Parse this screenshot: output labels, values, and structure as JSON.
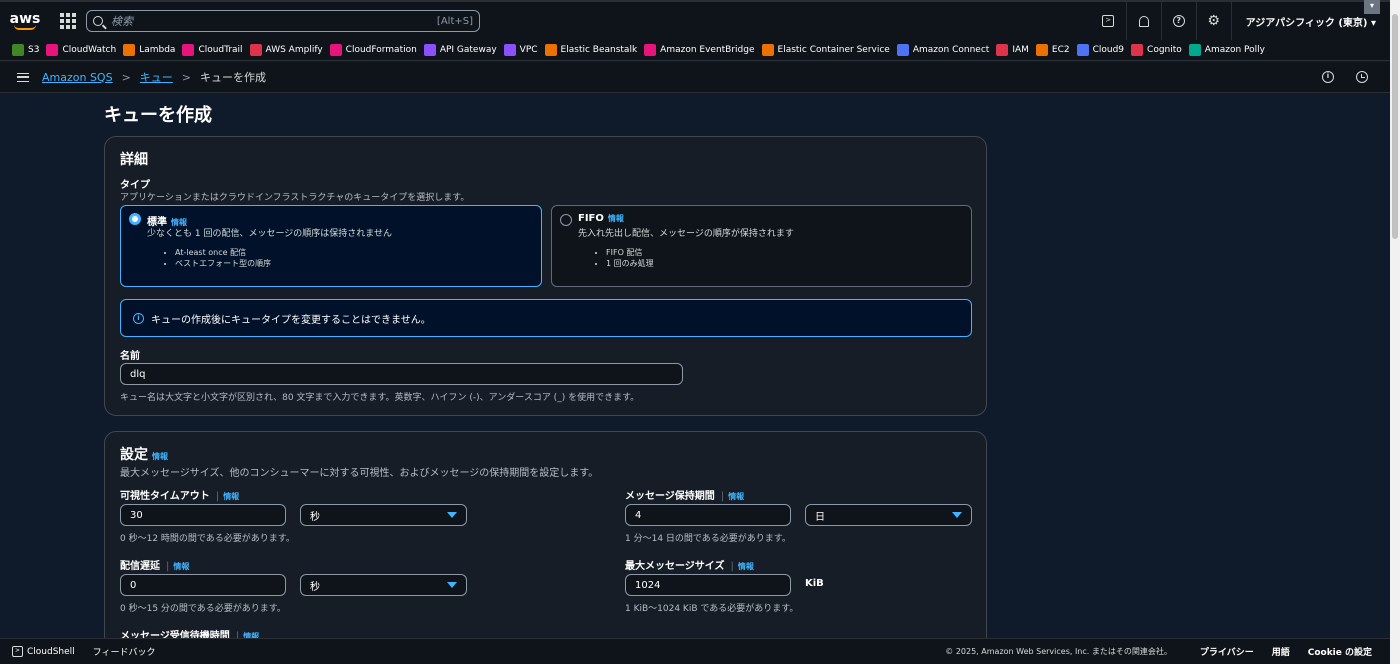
{
  "topbar": {
    "logo": "aws",
    "search_placeholder": "検索",
    "search_shortcut": "[Alt+S]",
    "region": "アジアパシフィック (東京) ▾",
    "corner": "▾"
  },
  "favorites": [
    {
      "label": "S3",
      "color": "#3f8624"
    },
    {
      "label": "CloudWatch",
      "color": "#e7157b"
    },
    {
      "label": "Lambda",
      "color": "#ed7100"
    },
    {
      "label": "CloudTrail",
      "color": "#e7157b"
    },
    {
      "label": "AWS Amplify",
      "color": "#dd344c"
    },
    {
      "label": "CloudFormation",
      "color": "#e7157b"
    },
    {
      "label": "API Gateway",
      "color": "#8c4fff"
    },
    {
      "label": "VPC",
      "color": "#8c4fff"
    },
    {
      "label": "Elastic Beanstalk",
      "color": "#ed7100"
    },
    {
      "label": "Amazon EventBridge",
      "color": "#e7157b"
    },
    {
      "label": "Elastic Container Service",
      "color": "#ed7100"
    },
    {
      "label": "Amazon Connect",
      "color": "#4d72f3"
    },
    {
      "label": "IAM",
      "color": "#dd344c"
    },
    {
      "label": "EC2",
      "color": "#ed7100"
    },
    {
      "label": "Cloud9",
      "color": "#4d72f3"
    },
    {
      "label": "Cognito",
      "color": "#dd344c"
    },
    {
      "label": "Amazon Polly",
      "color": "#01a88d"
    }
  ],
  "breadcrumb": {
    "items": [
      "Amazon SQS",
      "キュー"
    ],
    "current": "キューを作成",
    "sep": ">"
  },
  "page": {
    "title": "キューを作成"
  },
  "details": {
    "heading": "詳細",
    "type_label": "タイプ",
    "type_desc": "アプリケーションまたはクラウドインフラストラクチャのキュータイプを選択します。",
    "standard": {
      "title": "標準",
      "info": "情報",
      "desc": "少なくとも 1 回の配信、メッセージの順序は保持されません",
      "bullets": [
        "At-least once 配信",
        "ベストエフォート型の順序"
      ]
    },
    "fifo": {
      "title": "FIFO",
      "info": "情報",
      "desc": "先入れ先出し配信、メッセージの順序が保持されます",
      "bullets": [
        "FIFO 配信",
        "1 回のみ処理"
      ]
    },
    "alert": "キューの作成後にキュータイプを変更することはできません。",
    "name_label": "名前",
    "name_value": "dlq",
    "name_hint": "キュー名は大文字と小文字が区別され、80 文字まで入力できます。英数字、ハイフン (-)、アンダースコア (_) を使用できます。"
  },
  "settings": {
    "heading": "設定",
    "info": "情報",
    "desc": "最大メッセージサイズ、他のコンシューマーに対する可視性、およびメッセージの保持期間を設定します。",
    "visibility": {
      "label": "可視性タイムアウト",
      "info": "情報",
      "value": "30",
      "unit": "秒",
      "hint": "0 秒～12 時間の間である必要があります。"
    },
    "retention": {
      "label": "メッセージ保持期間",
      "info": "情報",
      "value": "4",
      "unit": "日",
      "hint": "1 分～14 日の間である必要があります。"
    },
    "delay": {
      "label": "配信遅延",
      "info": "情報",
      "value": "0",
      "unit": "秒",
      "hint": "0 秒～15 分の間である必要があります。"
    },
    "max_size": {
      "label": "最大メッセージサイズ",
      "info": "情報",
      "value": "1024",
      "unit": "KiB",
      "hint": "1 KiB～1024 KiB である必要があります。"
    },
    "receive_wait": {
      "label": "メッセージ受信待機時間",
      "info": "情報"
    }
  },
  "footer": {
    "cloudshell": "CloudShell",
    "feedback": "フィードバック",
    "copyright": "© 2025, Amazon Web Services, Inc. またはその関連会社。",
    "privacy": "プライバシー",
    "terms": "用語",
    "cookie": "Cookie の設定"
  },
  "colors": {
    "accent": "#42b4ff",
    "bg": "#0f1b2a",
    "container": "#161d26"
  }
}
